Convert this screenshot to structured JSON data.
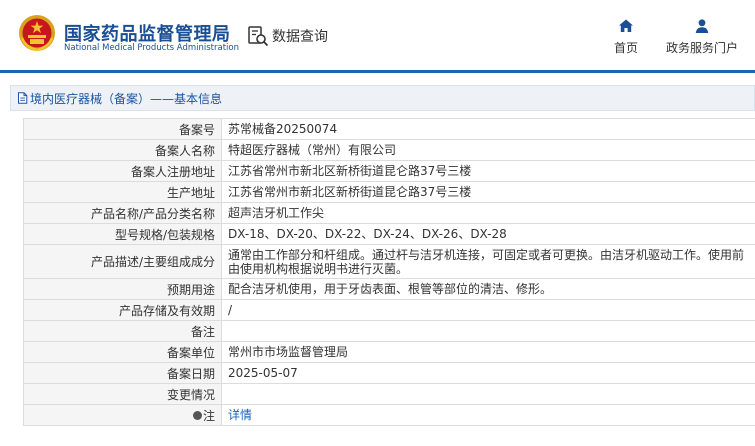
{
  "header": {
    "org_name_cn": "国家药品监督管理局",
    "org_name_en": "National Medical Products Administration",
    "search_label": "数据查询",
    "nav": [
      {
        "label": "首页",
        "icon": "home-icon"
      },
      {
        "label": "政务服务门户",
        "icon": "user-icon"
      }
    ]
  },
  "breadcrumb": {
    "icon": "document-icon",
    "text": "境内医疗器械（备案）——基本信息"
  },
  "colors": {
    "brand_blue": "#1a4f95",
    "header_line": "#1a66b3",
    "link": "#1a66b3",
    "label_bg": "#f5f5f5"
  },
  "record": [
    {
      "label": "备案号",
      "value": "苏常械备20250074"
    },
    {
      "label": "备案人名称",
      "value": "特超医疗器械（常州）有限公司"
    },
    {
      "label": "备案人注册地址",
      "value": "江苏省常州市新北区新桥街道昆仑路37号三楼"
    },
    {
      "label": "生产地址",
      "value": "江苏省常州市新北区新桥街道昆仑路37号三楼"
    },
    {
      "label": "产品名称/产品分类名称",
      "value": "超声洁牙机工作尖"
    },
    {
      "label": "型号规格/包装规格",
      "value": "DX-18、DX-20、DX-22、DX-24、DX-26、DX-28"
    },
    {
      "label": "产品描述/主要组成成分",
      "value": "通常由工作部分和杆组成。通过杆与洁牙机连接，可固定或者可更换。由洁牙机驱动工作。使用前由使用机构根据说明书进行灭菌。"
    },
    {
      "label": "预期用途",
      "value": "配合洁牙机使用，用于牙齿表面、根管等部位的清洁、修形。"
    },
    {
      "label": "产品存储及有效期",
      "value": "/"
    },
    {
      "label": "备注",
      "value": ""
    },
    {
      "label": "备案单位",
      "value": "常州市市场监督管理局"
    },
    {
      "label": "备案日期",
      "value": "2025-05-07"
    },
    {
      "label": "变更情况",
      "value": ""
    },
    {
      "label": "注",
      "value": "详情"
    }
  ]
}
